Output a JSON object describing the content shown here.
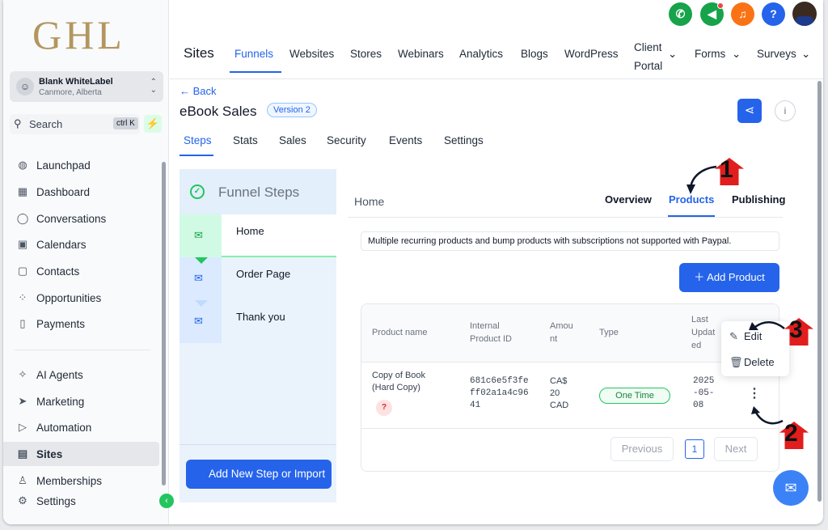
{
  "sidebar": {
    "logo": "GHL",
    "account": {
      "name": "Blank WhiteLabel",
      "location": "Canmore, Alberta"
    },
    "search": {
      "label": "Search",
      "shortcut": "ctrl K"
    },
    "items": [
      {
        "label": "Launchpad",
        "icon": "rocket-icon"
      },
      {
        "label": "Dashboard",
        "icon": "grid-icon"
      },
      {
        "label": "Conversations",
        "icon": "chat-icon"
      },
      {
        "label": "Calendars",
        "icon": "calendar-icon"
      },
      {
        "label": "Contacts",
        "icon": "contact-icon"
      },
      {
        "label": "Opportunities",
        "icon": "pipeline-icon"
      },
      {
        "label": "Payments",
        "icon": "payment-icon"
      },
      {
        "label": "AI Agents",
        "icon": "sparkle-icon"
      },
      {
        "label": "Marketing",
        "icon": "send-icon"
      },
      {
        "label": "Automation",
        "icon": "play-icon"
      },
      {
        "label": "Sites",
        "icon": "sites-icon"
      },
      {
        "label": "Memberships",
        "icon": "award-icon"
      },
      {
        "label": "Settings",
        "icon": "gear-icon"
      }
    ]
  },
  "header": {
    "section": "Sites",
    "tabs": [
      "Funnels",
      "Websites",
      "Stores",
      "Webinars",
      "Analytics",
      "Blogs",
      "WordPress",
      "Client Portal",
      "Forms",
      "Surveys"
    ],
    "icon_colors": {
      "phone": "#16a34a",
      "megaphone": "#16a34a",
      "bell": "#f97316",
      "help": "#2563eb"
    }
  },
  "funnel": {
    "back": "Back",
    "title": "eBook Sales",
    "version": "Version 2",
    "tabs": [
      "Steps",
      "Stats",
      "Sales",
      "Security",
      "Events",
      "Settings"
    ]
  },
  "steps": {
    "heading": "Funnel Steps",
    "items": [
      "Home",
      "Order Page",
      "Thank you"
    ],
    "add_button": "Add New Step or Import"
  },
  "content": {
    "page": "Home",
    "tabs": [
      "Overview",
      "Products",
      "Publishing"
    ],
    "notice": "Multiple recurring products and bump products with subscriptions not supported with Paypal.",
    "add_product": "Add Product",
    "table": {
      "headers": [
        "Product name",
        "Internal Product ID",
        "Amou nt",
        "Type",
        "Last Updat ed"
      ],
      "row": {
        "name": "Copy of Book (Hard Copy)",
        "id": "681c6e5f3fe ff02a1a4c96 41",
        "amount": "CA$ 20 CAD",
        "type": "One Time",
        "updated": "2025 -05- 08"
      }
    },
    "pagination": {
      "prev": "Previous",
      "page": "1",
      "next": "Next"
    },
    "menu": [
      "Edit",
      "Delete"
    ]
  },
  "annotations": [
    "1",
    "2",
    "3"
  ],
  "accent": "#2563eb"
}
